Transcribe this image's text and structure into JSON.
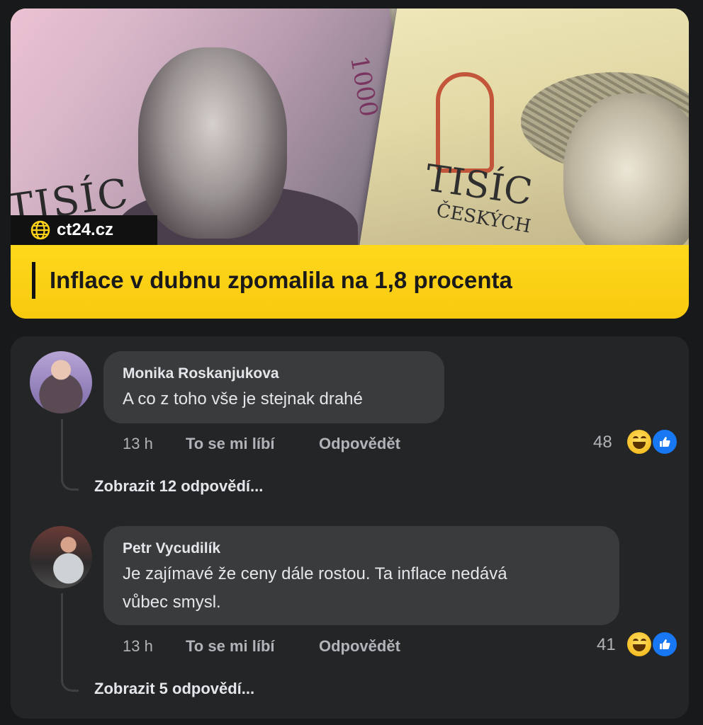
{
  "post": {
    "source": "ct24.cz",
    "headline": "Inflace v dubnu zpomalila na 1,8 procenta",
    "image_texts": {
      "left_word": "TISÍC",
      "left_denomination": "1000",
      "right_word": "TISÍC",
      "right_word_2": "ČESKÝCH"
    }
  },
  "comments": [
    {
      "author": "Monika Roskanjukova",
      "text": "A co z toho vše je stejnak drahé",
      "time": "13 h",
      "like_label": "To se mi líbí",
      "reply_label": "Odpovědět",
      "reaction_count": "48",
      "reactions": [
        "haha-icon",
        "like-icon"
      ],
      "view_replies": "Zobrazit 12 odpovědí..."
    },
    {
      "author": "Petr Vycudilík",
      "text_line1": "Je zajímavé že ceny dále rostou. Ta inflace nedává",
      "text_line2": "vůbec smysl.",
      "time": "13 h",
      "like_label": "To se mi líbí",
      "reply_label": "Odpovědět",
      "reaction_count": "41",
      "reactions": [
        "haha-icon",
        "like-icon"
      ],
      "view_replies": "Zobrazit 5 odpovědí..."
    }
  ],
  "colors": {
    "background": "#18191b",
    "panel": "#242527",
    "bubble": "#3a3b3c",
    "headline_bar": "#ffd21a",
    "like_blue": "#1877f2",
    "meta_gray": "#b0b3b8"
  }
}
